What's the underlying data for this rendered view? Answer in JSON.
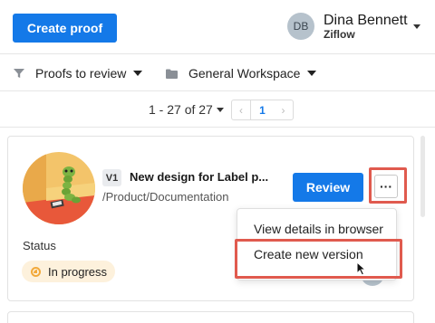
{
  "header": {
    "create_button_label": "Create proof",
    "user": {
      "initials": "DB",
      "name": "Dina Bennett",
      "org": "Ziflow"
    }
  },
  "filters": [
    {
      "label": "Proofs to review",
      "icon": "filter-icon"
    },
    {
      "label": "General Workspace",
      "icon": "folder-icon"
    }
  ],
  "pagination": {
    "range_label": "1 - 27 of 27",
    "current_page": "1",
    "prev_glyph": "‹",
    "next_glyph": "›"
  },
  "proof": {
    "version": "V1",
    "title": "New design for Label p...",
    "path": "/Product/Documentation",
    "review_label": "Review",
    "more_glyph": "···",
    "status_label": "Status",
    "status_value": "In progress"
  },
  "context_menu": {
    "items": [
      {
        "label": "View details in browser"
      },
      {
        "label": "Create new version"
      }
    ]
  },
  "colors": {
    "accent": "#1479e8",
    "highlight": "#e05a4e",
    "status_bg": "#fdf1dc",
    "status_icon": "#f2a93b"
  }
}
